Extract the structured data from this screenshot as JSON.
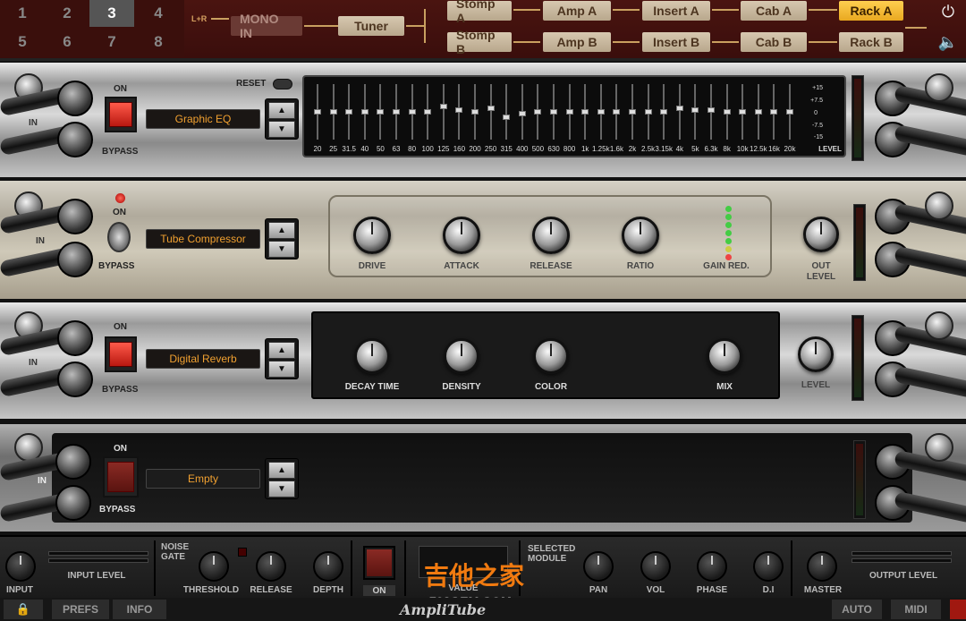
{
  "topbar": {
    "presets": [
      "1",
      "2",
      "3",
      "4",
      "5",
      "6",
      "7",
      "8"
    ],
    "active_preset": "3",
    "lr_label": "L+R",
    "mono_in": "MONO IN",
    "tuner": "Tuner",
    "stomp_a": "Stomp A",
    "stomp_b": "Stomp B",
    "amp_a": "Amp A",
    "amp_b": "Amp B",
    "insert_a": "Insert A",
    "insert_b": "Insert B",
    "cab_a": "Cab A",
    "cab_b": "Cab B",
    "rack_a": "Rack A",
    "rack_b": "Rack B",
    "power_icon": "⏻",
    "speaker_icon": "🔈"
  },
  "jacks": {
    "in": "IN",
    "out": "OUT",
    "reset": "RESET",
    "on": "ON",
    "bypass": "BYPASS"
  },
  "rack1": {
    "name": "Graphic EQ",
    "freqs": [
      "20",
      "25",
      "31.5",
      "40",
      "50",
      "63",
      "80",
      "100",
      "125",
      "160",
      "200",
      "250",
      "315",
      "400",
      "500",
      "630",
      "800",
      "1k",
      "1.25k",
      "1.6k",
      "2k",
      "2.5k",
      "3.15k",
      "4k",
      "5k",
      "6.3k",
      "8k",
      "10k",
      "12.5k",
      "16k",
      "20k"
    ],
    "gains": [
      0,
      0,
      0,
      0,
      0,
      0,
      0,
      0,
      3,
      1,
      0,
      2,
      -3,
      -1,
      0,
      0,
      0,
      0,
      0,
      0,
      0,
      0,
      0,
      2,
      1,
      1,
      0,
      0,
      0,
      0,
      0
    ],
    "db_labels": [
      "+15",
      "+7.5",
      "0",
      "-7.5",
      "-15"
    ],
    "level_label": "LEVEL"
  },
  "rack2": {
    "name": "Tube Compressor",
    "knobs": [
      "DRIVE",
      "ATTACK",
      "RELEASE",
      "RATIO"
    ],
    "gain_red": "GAIN RED.",
    "out_level_1": "OUT",
    "out_level_2": "LEVEL"
  },
  "rack3": {
    "name": "Digital Reverb",
    "knobs": [
      "DECAY TIME",
      "DENSITY",
      "COLOR",
      "MIX"
    ],
    "level": "LEVEL"
  },
  "rack4": {
    "name": "Empty"
  },
  "bottom": {
    "input": "INPUT",
    "input_level": "INPUT  LEVEL",
    "noise_gate_1": "NOISE",
    "noise_gate_2": "GATE",
    "threshold": "THRESHOLD",
    "release": "RELEASE",
    "depth": "DEPTH",
    "on": "ON",
    "value": "VALUE",
    "selected_1": "SELECTED",
    "selected_2": "MODULE",
    "pan": "PAN",
    "vol": "VOL",
    "phase": "PHASE",
    "di": "D.I",
    "master": "MASTER",
    "output_level": "OUTPUT  LEVEL"
  },
  "footer": {
    "prefs": "PREFS",
    "info": "INFO",
    "auto": "AUTO",
    "midi": "MIDI",
    "lock_icon": "🔒",
    "logo": "AmpliTube"
  },
  "watermark": {
    "main": "吉他之家",
    "sub": "798GEM.COM"
  }
}
